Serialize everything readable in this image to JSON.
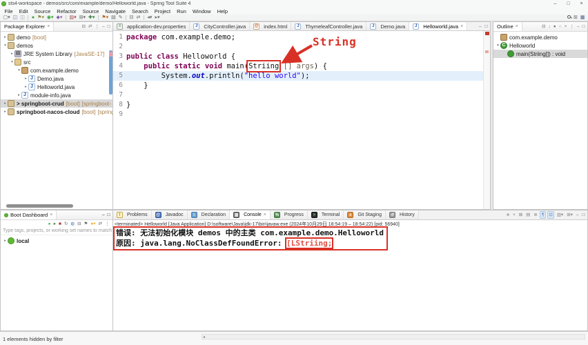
{
  "window": {
    "title": "sts4-workspace - demos/src/com/example/demo/Helloworld.java - Spring Tool Suite 4",
    "controls": [
      {
        "g": "–",
        "n": "minimize-button"
      },
      {
        "g": "□",
        "n": "maximize-button"
      },
      {
        "g": "×",
        "n": "close-button"
      }
    ]
  },
  "ui": {
    "close": "×"
  },
  "colors": {
    "error_red": "#e05045",
    "annotation_red": "#d93025",
    "keyword": "#7f0055",
    "string_blue": "#2a00ff",
    "static_field_blue": "#0000c0",
    "decorator_brown": "#a87e46",
    "selection_gray": "#d9d9d9",
    "current_line_blue": "#e3f0fb",
    "spring_green": "#5fb832"
  },
  "menu": [
    "File",
    "Edit",
    "Source",
    "Refactor",
    "Source",
    "Navigate",
    "Search",
    "Project",
    "Run",
    "Window",
    "Help"
  ],
  "toolbar": {
    "left": [
      {
        "g": "▢",
        "d": 1,
        "c": "#666",
        "n": "new-wizard-icon"
      },
      {
        "g": "◫",
        "c": "#7a6aa8",
        "n": "save-icon"
      },
      {
        "g": "◫",
        "c": "#999",
        "n": "save-all-icon"
      },
      {
        "sep": 1
      },
      {
        "g": "●",
        "c": "#3f9c35",
        "n": "skip-breakpoints-icon"
      },
      {
        "g": "⚑",
        "c": "#8a8a3a",
        "d": 1,
        "n": "debug-icon"
      },
      {
        "g": "◉",
        "c": "#2f9c2f",
        "d": 1,
        "n": "run-icon"
      },
      {
        "g": "◆",
        "c": "#8a5fb0",
        "d": 1,
        "n": "profile-icon"
      },
      {
        "sep": 1
      },
      {
        "g": "▨",
        "c": "#a84a4a",
        "d": 1,
        "n": "coverage-icon"
      },
      {
        "g": "⊞",
        "c": "#666",
        "d": 1,
        "n": "new-java-project-icon"
      },
      {
        "g": "✚",
        "c": "#2f7a2f",
        "d": 1,
        "n": "new-class-icon"
      },
      {
        "sep": 1
      },
      {
        "g": "⚑",
        "c": "#b5651d",
        "d": 1,
        "n": "external-tools-icon"
      },
      {
        "g": "▤",
        "c": "#666",
        "n": "open-type-icon"
      },
      {
        "g": "✎",
        "c": "#666",
        "n": "new-task-icon"
      },
      {
        "sep": 1
      },
      {
        "g": "⊟",
        "c": "#666",
        "n": "collapse-icon"
      },
      {
        "g": "⇄",
        "c": "#666",
        "n": "link-with-editor-icon"
      },
      {
        "sep": 1
      },
      {
        "g": "◂",
        "c": "#666",
        "d": 1,
        "n": "back-icon"
      },
      {
        "g": "▸",
        "c": "#666",
        "d": 1,
        "n": "forward-icon"
      }
    ],
    "right": [
      {
        "mag": 1,
        "n": "search-icon"
      },
      {
        "g": "⊞",
        "c": "#666",
        "n": "open-perspective-icon"
      },
      {
        "g": "▦",
        "c": "#44618a",
        "n": "java-perspective-icon"
      }
    ]
  },
  "icons": {
    "project": {
      "ch": "",
      "bg": "#d8c291",
      "bd": "#a08a58"
    },
    "library": {
      "ch": "▤",
      "bg": "#c8c8d4",
      "bd": "#8a8aa0",
      "fg": "#555"
    },
    "src-folder": {
      "ch": "",
      "bg": "#e2cb92",
      "bd": "#ad8d4d"
    },
    "package": {
      "ch": "",
      "bg": "#caa36b",
      "bd": "#96703a"
    },
    "java-file": {
      "ch": "J",
      "bg": "#ffffff",
      "bd": "#9ab6d8",
      "fg": "#2559a6"
    },
    "class": {
      "ch": "C",
      "bg": "#3f9c35",
      "bd": "#2c7a25",
      "fg": "#fff",
      "round": 1
    },
    "method": {
      "ch": "",
      "bg": "#3f9c35",
      "bd": "#2c7a25",
      "round": 1
    },
    "properties-file": {
      "ch": "≡",
      "bg": "#eef2ee",
      "bd": "#9aa89a",
      "fg": "#557755"
    },
    "html-file": {
      "ch": "@",
      "bg": "#ffffff",
      "bd": "#c8a878",
      "fg": "#c06020"
    },
    "problems": {
      "ch": "!",
      "bg": "#fdf3d0",
      "bd": "#c8a83a",
      "fg": "#8a6d1a"
    },
    "javadoc": {
      "ch": "@",
      "bg": "#4a72b8",
      "bd": "#355a9a",
      "fg": "#fff"
    },
    "declaration": {
      "ch": "≡",
      "bg": "#6aa0d0",
      "bd": "#4a80b0",
      "fg": "#fff"
    },
    "console": {
      "ch": "▥",
      "bg": "#707070",
      "bd": "#555",
      "fg": "#fff"
    },
    "progress": {
      "ch": "%",
      "bg": "#5a8f5a",
      "bd": "#3f7a3f",
      "fg": "#fff"
    },
    "terminal": {
      "ch": ">",
      "bg": "#2f2f2f",
      "bd": "#111",
      "fg": "#7fd77f"
    },
    "git": {
      "ch": "±",
      "bg": "#e08a3a",
      "bd": "#b06a20",
      "fg": "#fff"
    },
    "history": {
      "ch": "↺",
      "bg": "#9a9a9a",
      "bd": "#777",
      "fg": "#fff"
    },
    "boot-dot": {
      "ch": "",
      "bg": "#5fb832",
      "bd": "#47962a",
      "round": 1
    }
  },
  "package_explorer": {
    "title": "Package Explorer",
    "header_icons": [
      {
        "g": "⊟",
        "c": "#777",
        "n": "collapse-all-icon"
      },
      {
        "g": "⇄",
        "c": "#777",
        "n": "link-editor-icon"
      },
      {
        "g": "⋮",
        "c": "#777",
        "n": "view-menu-icon"
      },
      {
        "g": "–",
        "c": "#666",
        "n": "minimize-panel-icon"
      },
      {
        "g": "□",
        "c": "#666",
        "n": "maximize-panel-icon"
      }
    ],
    "items": [
      {
        "indent": 0,
        "arrow": "▸",
        "icon": "project",
        "label": "demo",
        "decorators": [
          "[boot]"
        ]
      },
      {
        "indent": 0,
        "arrow": "▾",
        "icon": "project",
        "label": "demos"
      },
      {
        "indent": 1,
        "arrow": "▸",
        "icon": "library",
        "label": "JRE System Library",
        "decorators": [
          "[JavaSE-17]"
        ]
      },
      {
        "indent": 1,
        "arrow": "▾",
        "icon": "src-folder",
        "label": "src"
      },
      {
        "indent": 2,
        "arrow": "▾",
        "icon": "package",
        "label": "com.example.demo"
      },
      {
        "indent": 3,
        "arrow": "▸",
        "icon": "java-file",
        "label": "Demo.java"
      },
      {
        "indent": 3,
        "arrow": "▸",
        "icon": "java-file",
        "label": "Helloworld.java"
      },
      {
        "indent": 2,
        "arrow": "▸",
        "icon": "java-file",
        "label": "module-info.java"
      },
      {
        "indent": 0,
        "arrow": "▸",
        "icon": "project",
        "label": "> springboot-crud",
        "bold": true,
        "selected": true,
        "decorators": [
          "[boot]",
          "[springboot-"
        ]
      },
      {
        "indent": 0,
        "arrow": "▸",
        "icon": "project",
        "label": "springboot-nacos-cloud",
        "bold": true,
        "decorators": [
          "[boot]",
          "[spring"
        ]
      }
    ]
  },
  "editor": {
    "tabs": [
      {
        "label": "application-dev.properties",
        "icon": "properties-file"
      },
      {
        "label": "CityController.java",
        "icon": "java-file"
      },
      {
        "label": "index.html",
        "icon": "html-file"
      },
      {
        "label": "ThymeleafController.java",
        "icon": "java-file"
      },
      {
        "label": "Demo.java",
        "icon": "java-file"
      },
      {
        "label": "Helloworld.java",
        "icon": "java-file",
        "active": true,
        "close": true
      }
    ],
    "tab_actions": [
      {
        "g": "–",
        "c": "#666",
        "n": "minimize-editor-icon"
      },
      {
        "g": "□",
        "c": "#666",
        "n": "maximize-editor-icon"
      }
    ],
    "annotation": {
      "label": "String"
    },
    "code": {
      "lines": [
        {
          "n": 1,
          "tokens": [
            {
              "t": "package",
              "c": "kw"
            },
            {
              "t": " com.example.demo;",
              "c": "pl"
            }
          ]
        },
        {
          "n": 2,
          "tokens": []
        },
        {
          "n": 3,
          "tokens": [
            {
              "t": "public",
              "c": "kw"
            },
            {
              "t": " ",
              "c": "pl"
            },
            {
              "t": "class",
              "c": "kw"
            },
            {
              "t": " Helloworld {",
              "c": "pl"
            }
          ]
        },
        {
          "n": 4,
          "tokens": [
            {
              "t": "    ",
              "c": "pl"
            },
            {
              "t": "public",
              "c": "kw"
            },
            {
              "t": " ",
              "c": "pl"
            },
            {
              "t": "static",
              "c": "kw"
            },
            {
              "t": " ",
              "c": "pl"
            },
            {
              "t": "void",
              "c": "kw"
            },
            {
              "t": " main(",
              "c": "pl"
            },
            {
              "t": "Striing",
              "c": "pl boxed"
            },
            {
              "t": " [] ",
              "c": "dim"
            },
            {
              "t": "args",
              "c": "dim"
            },
            {
              "t": ") {",
              "c": "pl"
            }
          ]
        },
        {
          "n": 5,
          "highlight": true,
          "tokens": [
            {
              "t": "        System.",
              "c": "pl"
            },
            {
              "t": "out",
              "c": "fld"
            },
            {
              "t": ".println(",
              "c": "pl"
            },
            {
              "t": "\"hello world\"",
              "c": "str"
            },
            {
              "t": ");",
              "c": "pl"
            }
          ]
        },
        {
          "n": 6,
          "tokens": [
            {
              "t": "    }",
              "c": "pl"
            }
          ]
        },
        {
          "n": 7,
          "tokens": []
        },
        {
          "n": 8,
          "tokens": [
            {
              "t": "}",
              "c": "pl"
            }
          ]
        },
        {
          "n": 9,
          "tokens": []
        }
      ]
    }
  },
  "outline": {
    "title": "Outline",
    "header_icons": [
      {
        "g": "⊟",
        "c": "#777",
        "n": "collapse-all-icon"
      },
      {
        "g": "↓",
        "c": "#777",
        "n": "sort-icon"
      },
      {
        "g": "●",
        "c": "#777",
        "n": "hide-fields-icon"
      },
      {
        "g": "○",
        "c": "#777",
        "n": "hide-static-members-icon"
      },
      {
        "g": "×",
        "c": "#777",
        "n": "hide-non-public-icon"
      },
      {
        "g": "⋮",
        "c": "#777",
        "n": "view-menu-icon"
      },
      {
        "g": "–",
        "c": "#666",
        "n": "minimize-panel-icon"
      },
      {
        "g": "□",
        "c": "#666",
        "n": "maximize-panel-icon"
      }
    ],
    "items": [
      {
        "indent": 0,
        "arrow": "",
        "icon": "package",
        "label": "com.example.demo"
      },
      {
        "indent": 0,
        "arrow": "▾",
        "icon": "class",
        "label": "Helloworld"
      },
      {
        "indent": 1,
        "arrow": "",
        "icon": "method",
        "label": "main(Striing[]) : void",
        "selected": true
      }
    ]
  },
  "console": {
    "tabs": [
      {
        "label": "Problems",
        "icon": "problems"
      },
      {
        "label": "Javadoc",
        "icon": "javadoc"
      },
      {
        "label": "Declaration",
        "icon": "declaration"
      },
      {
        "label": "Console",
        "icon": "console",
        "active": true,
        "close": true
      },
      {
        "label": "Progress",
        "icon": "progress"
      },
      {
        "label": "Terminal",
        "icon": "terminal"
      },
      {
        "label": "Git Staging",
        "icon": "git"
      },
      {
        "label": "History",
        "icon": "history"
      }
    ],
    "toolbar": [
      {
        "g": "■",
        "c": "#aaa",
        "n": "terminate-icon"
      },
      {
        "g": "×",
        "c": "#888",
        "n": "remove-launch-icon"
      },
      {
        "g": "⊠",
        "c": "#888",
        "n": "remove-all-launches-icon"
      },
      {
        "g": "▤",
        "c": "#888",
        "n": "clear-console-icon"
      },
      {
        "g": "≣",
        "c": "#888",
        "n": "scroll-lock-icon"
      },
      {
        "g": "¶",
        "c": "#4a7ab8",
        "pressed": 1,
        "n": "word-wrap-icon"
      },
      {
        "g": "⊡",
        "c": "#4a7ab8",
        "pressed": 1,
        "n": "pin-console-icon"
      },
      {
        "g": "▥",
        "c": "#888",
        "d": 1,
        "n": "display-console-icon"
      },
      {
        "g": "⊞",
        "c": "#888",
        "d": 1,
        "n": "open-console-icon"
      },
      {
        "g": "–",
        "c": "#666",
        "n": "minimize-panel-icon"
      },
      {
        "g": "□",
        "c": "#666",
        "n": "maximize-panel-icon"
      }
    ],
    "terminated_line": "<terminated> Helloworld [Java Application] D:\\software\\Java\\jdk-17\\bin\\javaw.exe (2024年10月29日 18:54:19 – 18:54:22) [pid: 56940]",
    "error_lines": [
      {
        "tokens": [
          {
            "t": "错误: 无法初始化模块 demos 中的主类 com.example.demo.Helloworld"
          }
        ]
      },
      {
        "tokens": [
          {
            "t": "原因: java.lang.NoClassDefFoundError: ",
            "c": ""
          },
          {
            "t": "[LStriing;",
            "c": "inner-box"
          }
        ]
      }
    ]
  },
  "boot_dashboard": {
    "title": "Boot Dashboard",
    "toolbar": [
      {
        "g": "▸",
        "c": "#3f9c35",
        "n": "start-icon"
      },
      {
        "g": "▸",
        "c": "#2f7a2f",
        "n": "debug-start-icon"
      },
      {
        "g": "■",
        "c": "#b03a2e",
        "n": "stop-icon"
      },
      {
        "g": "↻",
        "c": "#666",
        "n": "restart-icon"
      },
      {
        "g": "◍",
        "c": "#3a74c2",
        "n": "open-browser-icon"
      },
      {
        "g": "⊟",
        "c": "#666",
        "n": "collapse-all-icon"
      },
      {
        "g": "⚑",
        "c": "#666",
        "n": "tag-icon"
      },
      {
        "g": "●",
        "c": "#e0b030",
        "d": 1,
        "n": "bulb-icon"
      },
      {
        "g": "⇄",
        "c": "#666",
        "n": "link-icon"
      },
      {
        "g": "⋮",
        "c": "#666",
        "n": "view-menu-icon"
      }
    ],
    "filter_placeholder": "Type tags, projects, or working set names to match (in",
    "items": [
      {
        "indent": 0,
        "arrow": "▸",
        "icon": "boot-dot",
        "label": "local",
        "bold": true
      }
    ]
  },
  "status": {
    "left": "1 elements hidden by filter"
  }
}
